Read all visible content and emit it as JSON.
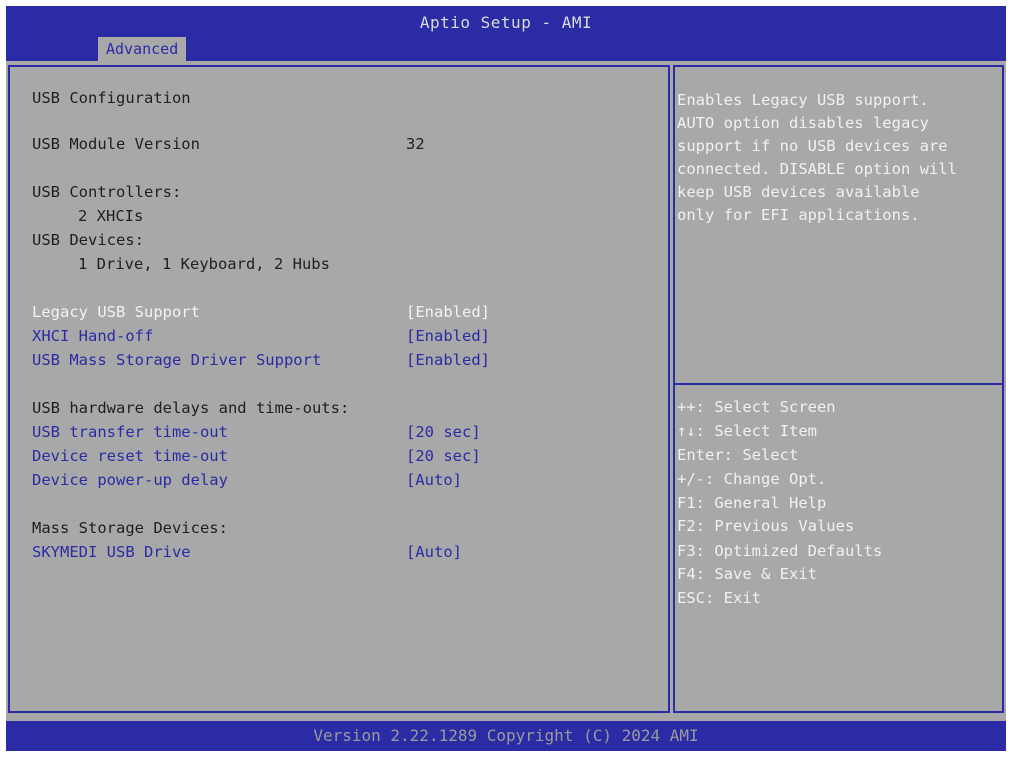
{
  "header": {
    "title": "Aptio Setup - AMI",
    "tab": "Advanced"
  },
  "main": {
    "section_title": "USB Configuration",
    "module_label": "USB Module Version",
    "module_value": "32",
    "controllers_label": "USB Controllers:",
    "controllers_value": "2 XHCIs",
    "devices_label": "USB Devices:",
    "devices_value": "1 Drive, 1 Keyboard, 2 Hubs",
    "settings": [
      {
        "label": "Legacy USB Support",
        "value": "[Enabled]"
      },
      {
        "label": "XHCI Hand-off",
        "value": "[Enabled]"
      },
      {
        "label": "USB Mass Storage Driver Support",
        "value": "[Enabled]"
      }
    ],
    "delays_header": "USB hardware delays and time-outs:",
    "delays": [
      {
        "label": "USB transfer time-out",
        "value": "[20 sec]"
      },
      {
        "label": "Device reset time-out",
        "value": "[20 sec]"
      },
      {
        "label": "Device power-up delay",
        "value": "[Auto]"
      }
    ],
    "mass_header": "Mass Storage Devices:",
    "mass_device": {
      "label": "SKYMEDI USB Drive",
      "value": "[Auto]"
    }
  },
  "help": {
    "lines": [
      "Enables Legacy USB support.",
      "AUTO option disables legacy",
      "support if no USB devices are",
      "connected. DISABLE option will",
      "keep USB devices available",
      "only for EFI applications."
    ]
  },
  "keys": [
    "++: Select Screen",
    "↑↓: Select Item",
    "Enter: Select",
    "+/-: Change Opt.",
    "F1: General Help",
    "F2: Previous Values",
    "F3: Optimized Defaults",
    "F4: Save & Exit",
    "ESC: Exit"
  ],
  "footer": {
    "version": "Version 2.22.1289 Copyright (C) 2024 AMI"
  },
  "colors": {
    "background": "#a8a8a8",
    "bar_blue": "#2b2ba6",
    "selected_text": "#f3f3f3",
    "label_text": "#202020"
  }
}
